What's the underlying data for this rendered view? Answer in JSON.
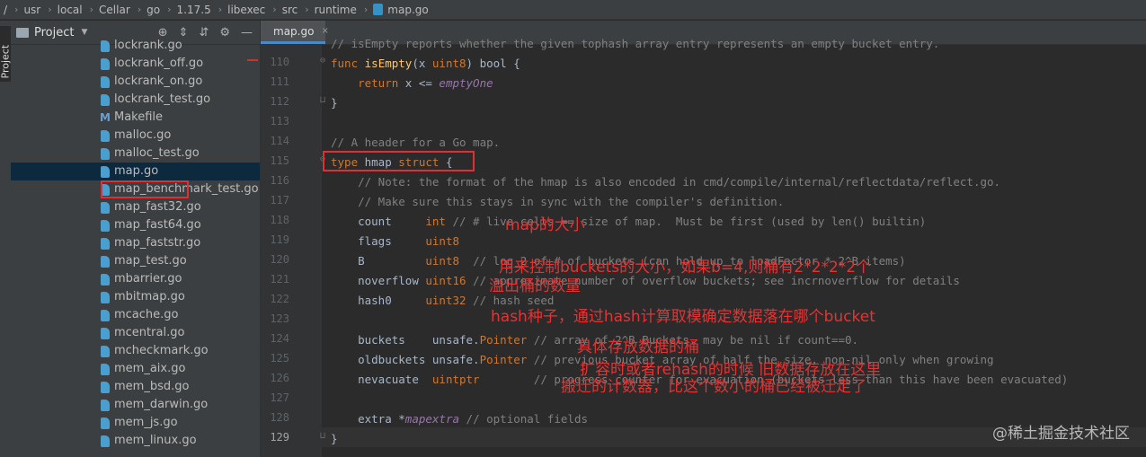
{
  "breadcrumbs": [
    "/",
    "usr",
    "local",
    "Cellar",
    "go",
    "1.17.5",
    "libexec",
    "src",
    "runtime",
    "map.go"
  ],
  "sidebar_strip_label": "Project",
  "project_panel": {
    "title": "Project",
    "tools": [
      "⊕",
      "⇕",
      "⇵",
      "⚙",
      "—"
    ]
  },
  "files": [
    {
      "name": "lockrank.go",
      "type": "go"
    },
    {
      "name": "lockrank_off.go",
      "type": "go"
    },
    {
      "name": "lockrank_on.go",
      "type": "go"
    },
    {
      "name": "lockrank_test.go",
      "type": "go"
    },
    {
      "name": "Makefile",
      "type": "make"
    },
    {
      "name": "malloc.go",
      "type": "go"
    },
    {
      "name": "malloc_test.go",
      "type": "go"
    },
    {
      "name": "map.go",
      "type": "go",
      "selected": true
    },
    {
      "name": "map_benchmark_test.go",
      "type": "go"
    },
    {
      "name": "map_fast32.go",
      "type": "go"
    },
    {
      "name": "map_fast64.go",
      "type": "go"
    },
    {
      "name": "map_faststr.go",
      "type": "go"
    },
    {
      "name": "map_test.go",
      "type": "go"
    },
    {
      "name": "mbarrier.go",
      "type": "go"
    },
    {
      "name": "mbitmap.go",
      "type": "go"
    },
    {
      "name": "mcache.go",
      "type": "go"
    },
    {
      "name": "mcentral.go",
      "type": "go"
    },
    {
      "name": "mcheckmark.go",
      "type": "go"
    },
    {
      "name": "mem_aix.go",
      "type": "go"
    },
    {
      "name": "mem_bsd.go",
      "type": "go"
    },
    {
      "name": "mem_darwin.go",
      "type": "go"
    },
    {
      "name": "mem_js.go",
      "type": "go"
    },
    {
      "name": "mem_linux.go",
      "type": "go"
    }
  ],
  "editor_tab": {
    "label": "map.go",
    "close": "×"
  },
  "line_numbers": [
    "110",
    "111",
    "112",
    "113",
    "114",
    "115",
    "116",
    "117",
    "118",
    "119",
    "120",
    "121",
    "122",
    "123",
    "124",
    "125",
    "126",
    "127",
    "128",
    "129"
  ],
  "code_top": "// isEmpty reports whether the given tophash array entry represents an empty bucket entry.",
  "code": {
    "l110": {
      "kw": "func",
      "fn": "isEmpty",
      "rest": "(x ",
      "tp": "uint8",
      "tail": ") bool {"
    },
    "l111": {
      "kw": "return",
      "mid": " x <= ",
      "em": "emptyOne"
    },
    "l112": "}",
    "l114": "// A header for a Go map.",
    "l115": {
      "kw": "type",
      "rest": " hmap ",
      "kw2": "struct",
      "tail": " {"
    },
    "l116": "// Note: the format of the hmap is also encoded in cmd/compile/internal/reflectdata/reflect.go.",
    "l117": "// Make sure this stays in sync with the compiler's definition.",
    "l118": {
      "field": "count     ",
      "type": "int",
      "comment": " // # live cells == size of map.  Must be first (used by len() builtin)"
    },
    "l119": {
      "field": "flags     ",
      "type": "uint8",
      "comment": ""
    },
    "l120": {
      "field": "B         ",
      "type": "uint8",
      "comment": "  // log_2 of # of buckets (can hold up to loadFactor * 2^B items)"
    },
    "l121": {
      "field": "noverflow ",
      "type": "uint16",
      "comment": " // approximate number of overflow buckets; see incrnoverflow for details"
    },
    "l122": {
      "field": "hash0     ",
      "type": "uint32",
      "comment": " // hash seed"
    },
    "l124": {
      "field": "buckets    ",
      "pkg": "unsafe.",
      "type": "Pointer",
      "comment": " // array of 2^B Buckets. may be nil if count==0."
    },
    "l125": {
      "field": "oldbuckets ",
      "pkg": "unsafe.",
      "type": "Pointer",
      "comment": " // previous bucket array of half the size, non-nil only when growing"
    },
    "l126": {
      "field": "nevacuate  ",
      "type": "uintptr",
      "comment": "        // progress counter for evacuation (buckets less than this have been evacuated)"
    },
    "l128": {
      "field": "extra ",
      "star": "*",
      "type": "mapextra",
      "comment": " // optional fields"
    },
    "l129": "}"
  },
  "annotations": {
    "count": "map的大小",
    "B": "用来控制buckets的大小，如果b=4,则桶有2*2*2*2个",
    "noverflow": "溢出桶的数量",
    "hash0": "hash种子，通过hash计算取模确定数据落在哪个bucket",
    "buckets": "具体存放数据的桶",
    "oldbuckets": "扩容时或者rehash的时候 旧数据存放在这里",
    "nevacuate": "搬迁的计数器，比这个数小的桶已经被迁走了"
  },
  "watermark": "@稀土掘金技术社区"
}
